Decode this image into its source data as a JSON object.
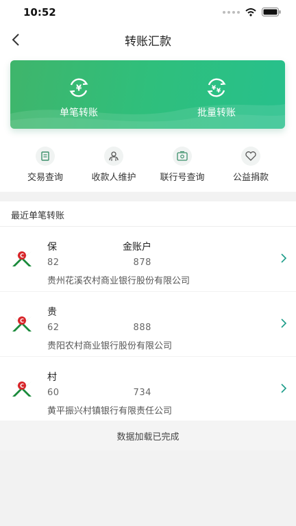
{
  "status": {
    "time": "10:52"
  },
  "header": {
    "title": "转账汇款"
  },
  "banner": {
    "items": [
      {
        "label": "单笔转账",
        "icon": "yuan-exchange-icon"
      },
      {
        "label": "批量转账",
        "icon": "batch-exchange-icon"
      }
    ]
  },
  "quick_actions": [
    {
      "label": "交易查询",
      "icon": "document-icon"
    },
    {
      "label": "收款人维护",
      "icon": "payee-icon"
    },
    {
      "label": "联行号查询",
      "icon": "bank-code-icon"
    },
    {
      "label": "公益捐款",
      "icon": "heart-icon"
    }
  ],
  "recent": {
    "heading": "最近单笔转账",
    "items": [
      {
        "name": "保…金账户",
        "name_start": "保",
        "name_end": "金账户",
        "account_start": "82",
        "account_end": "878",
        "bank": "贵州花溪农村商业银行股份有限公司"
      },
      {
        "name": "贵…",
        "name_start": "贵",
        "name_end": "",
        "account_start": "62",
        "account_end": "888",
        "bank": "贵阳农村商业银行股份有限公司"
      },
      {
        "name": "村…",
        "name_start": "村",
        "name_end": "",
        "account_start": "60",
        "account_end": "734",
        "bank": "黄平振兴村镇银行有限责任公司"
      }
    ]
  },
  "footer": {
    "text": "数据加载已完成"
  },
  "colors": {
    "accent": "#2fbf7c",
    "logo_red": "#d8262b",
    "logo_green": "#1a8a3b"
  }
}
